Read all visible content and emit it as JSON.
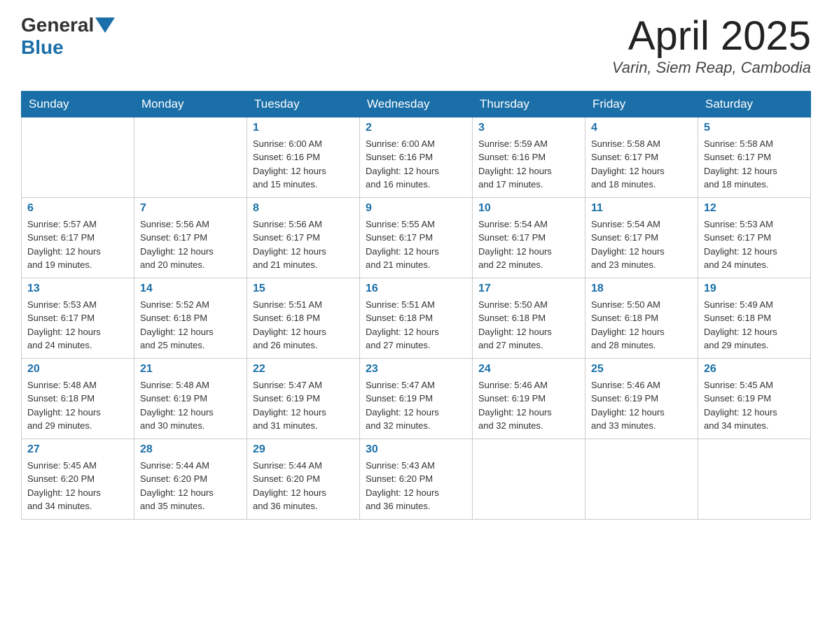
{
  "header": {
    "logo_general": "General",
    "logo_blue": "Blue",
    "month_title": "April 2025",
    "location": "Varin, Siem Reap, Cambodia"
  },
  "days_of_week": [
    "Sunday",
    "Monday",
    "Tuesday",
    "Wednesday",
    "Thursday",
    "Friday",
    "Saturday"
  ],
  "weeks": [
    [
      {
        "day": "",
        "info": ""
      },
      {
        "day": "",
        "info": ""
      },
      {
        "day": "1",
        "info": "Sunrise: 6:00 AM\nSunset: 6:16 PM\nDaylight: 12 hours\nand 15 minutes."
      },
      {
        "day": "2",
        "info": "Sunrise: 6:00 AM\nSunset: 6:16 PM\nDaylight: 12 hours\nand 16 minutes."
      },
      {
        "day": "3",
        "info": "Sunrise: 5:59 AM\nSunset: 6:16 PM\nDaylight: 12 hours\nand 17 minutes."
      },
      {
        "day": "4",
        "info": "Sunrise: 5:58 AM\nSunset: 6:17 PM\nDaylight: 12 hours\nand 18 minutes."
      },
      {
        "day": "5",
        "info": "Sunrise: 5:58 AM\nSunset: 6:17 PM\nDaylight: 12 hours\nand 18 minutes."
      }
    ],
    [
      {
        "day": "6",
        "info": "Sunrise: 5:57 AM\nSunset: 6:17 PM\nDaylight: 12 hours\nand 19 minutes."
      },
      {
        "day": "7",
        "info": "Sunrise: 5:56 AM\nSunset: 6:17 PM\nDaylight: 12 hours\nand 20 minutes."
      },
      {
        "day": "8",
        "info": "Sunrise: 5:56 AM\nSunset: 6:17 PM\nDaylight: 12 hours\nand 21 minutes."
      },
      {
        "day": "9",
        "info": "Sunrise: 5:55 AM\nSunset: 6:17 PM\nDaylight: 12 hours\nand 21 minutes."
      },
      {
        "day": "10",
        "info": "Sunrise: 5:54 AM\nSunset: 6:17 PM\nDaylight: 12 hours\nand 22 minutes."
      },
      {
        "day": "11",
        "info": "Sunrise: 5:54 AM\nSunset: 6:17 PM\nDaylight: 12 hours\nand 23 minutes."
      },
      {
        "day": "12",
        "info": "Sunrise: 5:53 AM\nSunset: 6:17 PM\nDaylight: 12 hours\nand 24 minutes."
      }
    ],
    [
      {
        "day": "13",
        "info": "Sunrise: 5:53 AM\nSunset: 6:17 PM\nDaylight: 12 hours\nand 24 minutes."
      },
      {
        "day": "14",
        "info": "Sunrise: 5:52 AM\nSunset: 6:18 PM\nDaylight: 12 hours\nand 25 minutes."
      },
      {
        "day": "15",
        "info": "Sunrise: 5:51 AM\nSunset: 6:18 PM\nDaylight: 12 hours\nand 26 minutes."
      },
      {
        "day": "16",
        "info": "Sunrise: 5:51 AM\nSunset: 6:18 PM\nDaylight: 12 hours\nand 27 minutes."
      },
      {
        "day": "17",
        "info": "Sunrise: 5:50 AM\nSunset: 6:18 PM\nDaylight: 12 hours\nand 27 minutes."
      },
      {
        "day": "18",
        "info": "Sunrise: 5:50 AM\nSunset: 6:18 PM\nDaylight: 12 hours\nand 28 minutes."
      },
      {
        "day": "19",
        "info": "Sunrise: 5:49 AM\nSunset: 6:18 PM\nDaylight: 12 hours\nand 29 minutes."
      }
    ],
    [
      {
        "day": "20",
        "info": "Sunrise: 5:48 AM\nSunset: 6:18 PM\nDaylight: 12 hours\nand 29 minutes."
      },
      {
        "day": "21",
        "info": "Sunrise: 5:48 AM\nSunset: 6:19 PM\nDaylight: 12 hours\nand 30 minutes."
      },
      {
        "day": "22",
        "info": "Sunrise: 5:47 AM\nSunset: 6:19 PM\nDaylight: 12 hours\nand 31 minutes."
      },
      {
        "day": "23",
        "info": "Sunrise: 5:47 AM\nSunset: 6:19 PM\nDaylight: 12 hours\nand 32 minutes."
      },
      {
        "day": "24",
        "info": "Sunrise: 5:46 AM\nSunset: 6:19 PM\nDaylight: 12 hours\nand 32 minutes."
      },
      {
        "day": "25",
        "info": "Sunrise: 5:46 AM\nSunset: 6:19 PM\nDaylight: 12 hours\nand 33 minutes."
      },
      {
        "day": "26",
        "info": "Sunrise: 5:45 AM\nSunset: 6:19 PM\nDaylight: 12 hours\nand 34 minutes."
      }
    ],
    [
      {
        "day": "27",
        "info": "Sunrise: 5:45 AM\nSunset: 6:20 PM\nDaylight: 12 hours\nand 34 minutes."
      },
      {
        "day": "28",
        "info": "Sunrise: 5:44 AM\nSunset: 6:20 PM\nDaylight: 12 hours\nand 35 minutes."
      },
      {
        "day": "29",
        "info": "Sunrise: 5:44 AM\nSunset: 6:20 PM\nDaylight: 12 hours\nand 36 minutes."
      },
      {
        "day": "30",
        "info": "Sunrise: 5:43 AM\nSunset: 6:20 PM\nDaylight: 12 hours\nand 36 minutes."
      },
      {
        "day": "",
        "info": ""
      },
      {
        "day": "",
        "info": ""
      },
      {
        "day": "",
        "info": ""
      }
    ]
  ]
}
